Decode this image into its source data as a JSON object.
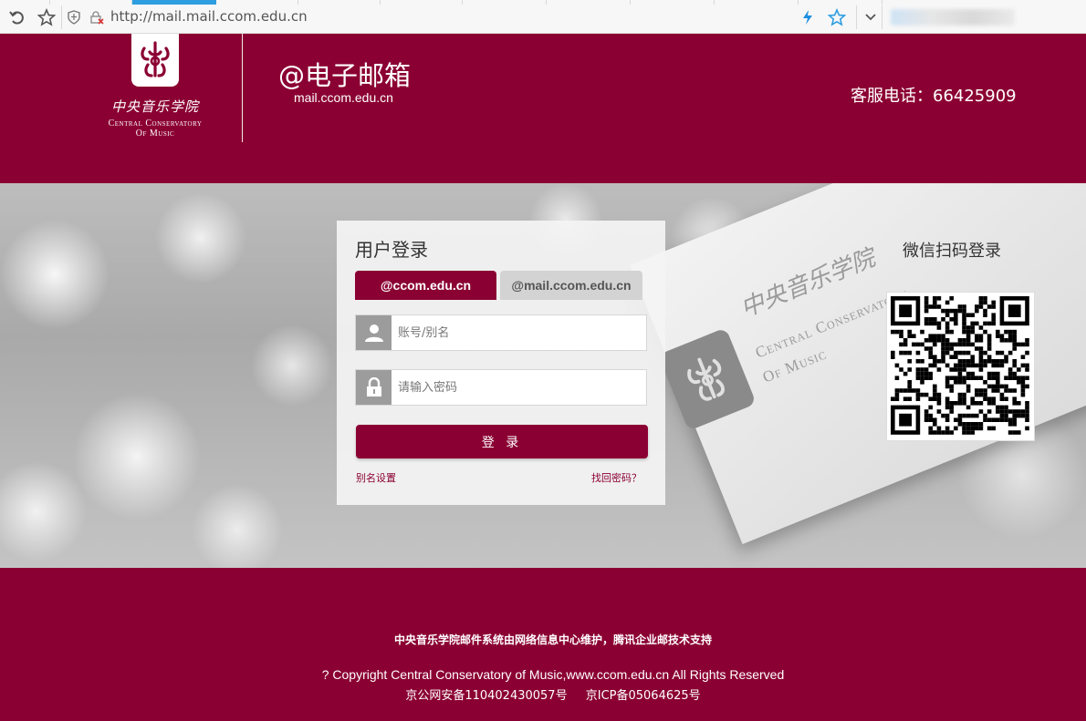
{
  "browser": {
    "url": "http://mail.mail.ccom.edu.cn",
    "icons": [
      "undo-icon",
      "star-icon",
      "shield-icon",
      "insecure-lock-icon",
      "lightning-icon",
      "bookmark-star-icon",
      "chevron-down-icon"
    ]
  },
  "header": {
    "logo_cn": "中央音乐学院",
    "logo_en_line1": "Central Conservatory",
    "logo_en_line2": "Of Music",
    "title": "@电子邮箱",
    "domain": "mail.ccom.edu.cn",
    "hotline": "客服电话：66425909"
  },
  "colors": {
    "brand": "#8b0032"
  },
  "hero_card": {
    "cn": "中央音乐学院",
    "en1": "Central Conservatory",
    "en2": "Of Music"
  },
  "login": {
    "title": "用户登录",
    "tabs": [
      {
        "label": "@ccom.edu.cn",
        "active": true
      },
      {
        "label": "@mail.ccom.edu.cn",
        "active": false
      }
    ],
    "account": {
      "placeholder": "账号/别名",
      "value": ""
    },
    "password": {
      "placeholder": "请输入密码",
      "value": ""
    },
    "submit_label": "登 录",
    "alias_link": "别名设置",
    "forgot_link": "找回密码？"
  },
  "wechat": {
    "title": "微信扫码登录"
  },
  "footer": {
    "line1": "中央音乐学院邮件系统由网络信息中心维护，腾讯企业邮技术支持",
    "line2": "? Copyright Central Conservatory of Music,www.ccom.edu.cn All Rights Reserved",
    "beian": "京公网安备110402430057号",
    "icp": "京ICP备05064625号"
  }
}
